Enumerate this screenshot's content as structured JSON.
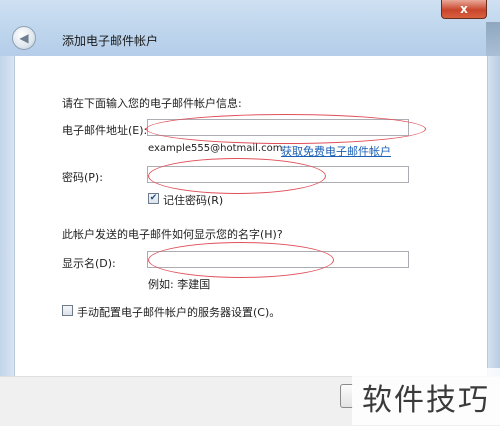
{
  "window": {
    "title": "添加电子邮件帐户",
    "close_label": "x"
  },
  "form": {
    "intro": "请在下面输入您的电子邮件帐户信息:",
    "email_label": "电子邮件地址(E):",
    "email_value": "",
    "email_example": "example555@hotmail.com",
    "free_account_link": "获取免费电子邮件帐户",
    "password_label": "密码(P):",
    "password_value": "",
    "remember_password_label": "记住密码(R)",
    "remember_password_checked": true,
    "display_name_heading": "此帐户发送的电子邮件如何显示您的名字(H)?",
    "display_name_label": "显示名(D):",
    "display_name_value": "",
    "display_name_example": "例如: 李建国",
    "manual_config_label": "手动配置电子邮件帐户的服务器设置(C)。",
    "manual_config_checked": false
  },
  "watermark": {
    "text": "软件技巧"
  },
  "colors": {
    "annotation_oval": "#e0505a",
    "link": "#1a5fb4"
  }
}
